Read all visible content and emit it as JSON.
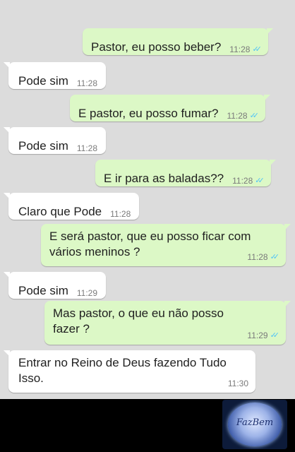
{
  "messages": [
    {
      "dir": "out",
      "text": "Pastor, eu posso beber?",
      "time": "11:28",
      "ticks": "✓✓"
    },
    {
      "dir": "in",
      "text": "Pode sim",
      "time": "11:28"
    },
    {
      "dir": "out",
      "text": "E pastor, eu posso fumar?",
      "time": "11:28",
      "ticks": "✓✓"
    },
    {
      "dir": "in",
      "text": "Pode sim",
      "time": "11:28"
    },
    {
      "dir": "out",
      "text": "E ir para as baladas??",
      "time": "11:28",
      "ticks": "✓✓"
    },
    {
      "dir": "in",
      "text": "Claro que Pode",
      "time": "11:28"
    },
    {
      "dir": "out",
      "text": "E será pastor, que eu posso ficar com\nvários meninos ?",
      "time": "11:28",
      "ticks": "✓✓"
    },
    {
      "dir": "in",
      "text": "Pode sim",
      "time": "11:29"
    },
    {
      "dir": "out",
      "text": "Mas pastor, o que eu não posso\nfazer ?",
      "time": "11:29",
      "ticks": "✓✓"
    },
    {
      "dir": "in",
      "text": "Entrar no Reino de Deus fazendo Tudo\nIsso.",
      "time": "11:30"
    }
  ],
  "watermark": {
    "text": "FazBem"
  },
  "colors": {
    "outgoing": "#dcf8c6",
    "incoming": "#ffffff",
    "background": "#dcdcdc",
    "ticks": "#4fc3f7"
  }
}
